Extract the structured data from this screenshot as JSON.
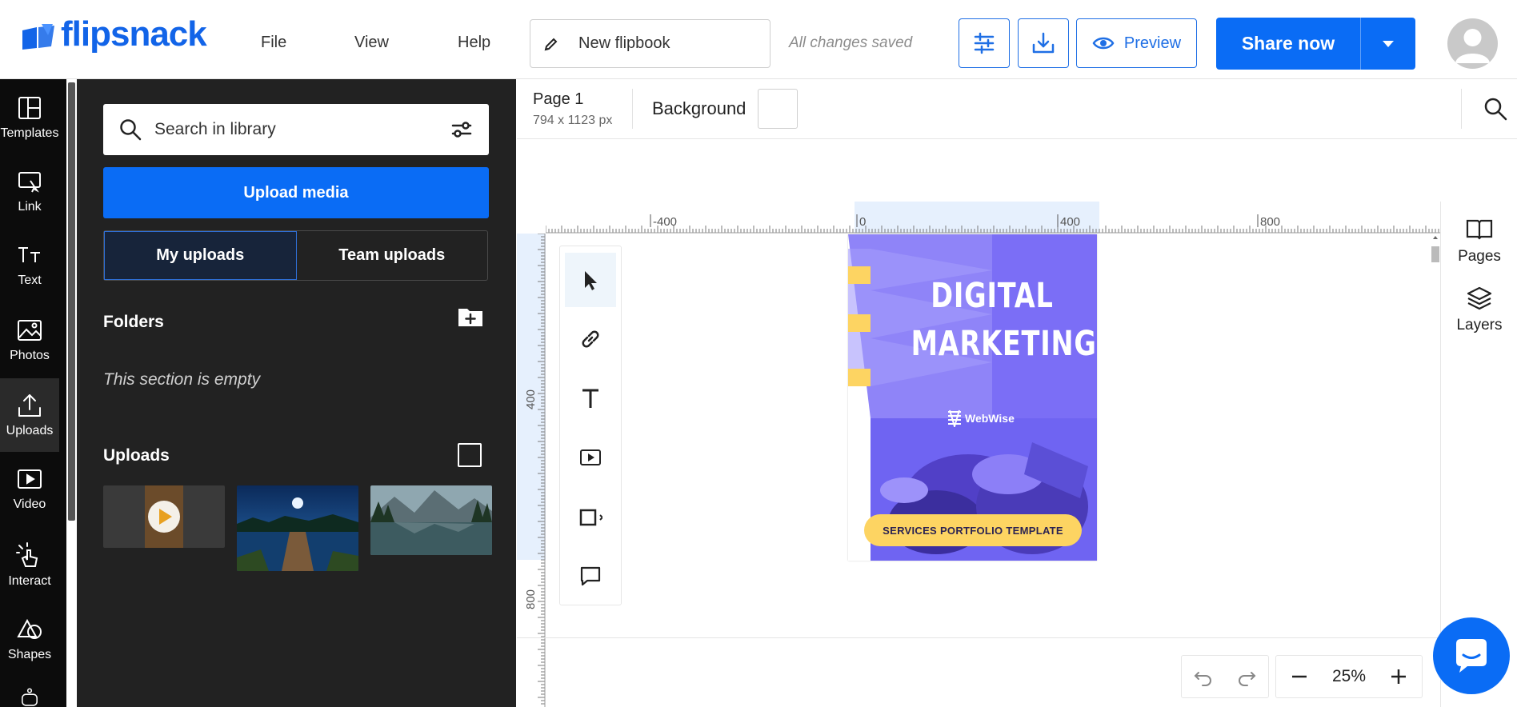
{
  "brand": {
    "name": "flipsnack",
    "color": "#1264e8"
  },
  "menu": {
    "file": "File",
    "view": "View",
    "help": "Help"
  },
  "document": {
    "title": "New flipbook",
    "save_status": "All changes saved"
  },
  "toolbar": {
    "settings_icon": "sliders-icon",
    "download_icon": "download-icon",
    "preview_label": "Preview",
    "share_label": "Share now"
  },
  "rail": {
    "items": [
      {
        "label": "Templates",
        "icon": "templates-icon"
      },
      {
        "label": "Link",
        "icon": "link-icon"
      },
      {
        "label": "Text",
        "icon": "text-icon"
      },
      {
        "label": "Photos",
        "icon": "photos-icon"
      },
      {
        "label": "Uploads",
        "icon": "uploads-icon",
        "active": true
      },
      {
        "label": "Video",
        "icon": "video-icon"
      },
      {
        "label": "Interact",
        "icon": "interact-icon"
      },
      {
        "label": "Shapes",
        "icon": "shapes-icon"
      }
    ]
  },
  "panel": {
    "search_placeholder": "Search in library",
    "upload_label": "Upload media",
    "tabs": {
      "my": "My uploads",
      "team": "Team uploads"
    },
    "folders_heading": "Folders",
    "empty_text": "This section is empty",
    "uploads_heading": "Uploads"
  },
  "page": {
    "label": "Page 1",
    "dimensions": "794 x 1123 px",
    "background_label": "Background"
  },
  "ruler": {
    "h_ticks": [
      "-400",
      "0",
      "400",
      "800"
    ],
    "v_ticks": [
      "400",
      "800"
    ]
  },
  "flipbook": {
    "title_line1": "DIGITAL",
    "title_line2": "MARKETING",
    "brand": "WebWise",
    "pill": "SERVICES PORTFOLIO TEMPLATE",
    "bg_color": "#7b6ef6",
    "accent_color": "#fdd462"
  },
  "right_rail": {
    "pages": "Pages",
    "layers": "Layers"
  },
  "zoom": {
    "level": "25%"
  },
  "colors": {
    "primary": "#0a6cf5",
    "panel_bg": "#222222",
    "rail_bg": "#0c0c0c"
  }
}
